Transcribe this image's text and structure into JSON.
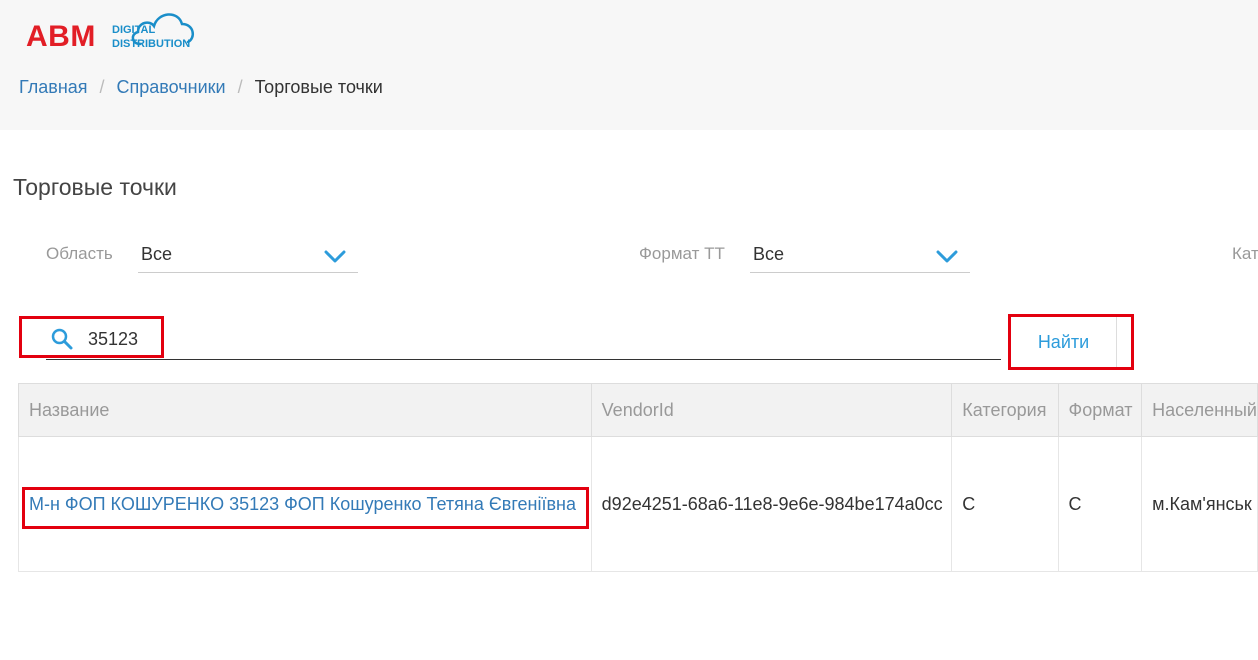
{
  "logo": {
    "brand": "ABM",
    "line1": "DIGITAL",
    "line2": "DISTRIBUTION"
  },
  "breadcrumb": {
    "home": "Главная",
    "directories": "Справочники",
    "current": "Торговые точки",
    "separator": "/"
  },
  "page": {
    "title": "Торговые точки"
  },
  "filters": {
    "region": {
      "label": "Область",
      "value": "Все"
    },
    "format": {
      "label": "Формат ТТ",
      "value": "Все"
    },
    "category": {
      "label": "Кат"
    }
  },
  "search": {
    "value": "35123",
    "button_label": "Найти"
  },
  "table": {
    "headers": [
      "Название",
      "VendorId",
      "Категория",
      "Формат",
      "Населенный"
    ],
    "rows": [
      {
        "name": "М-н ФОП КОШУРЕНКО 35123 ФОП Кошуренко Тетяна Євгеніївна",
        "vendor_id": "d92e4251-68a6-11e8-9e6e-984be174a0cc",
        "category": "С",
        "format": "С",
        "city": "м.Кам'янськ"
      }
    ]
  },
  "colors": {
    "brand_red": "#e21e26",
    "brand_blue": "#1a8ec9",
    "link": "#337ab7",
    "accent": "#2d9cdb",
    "highlight": "#e3000f"
  }
}
